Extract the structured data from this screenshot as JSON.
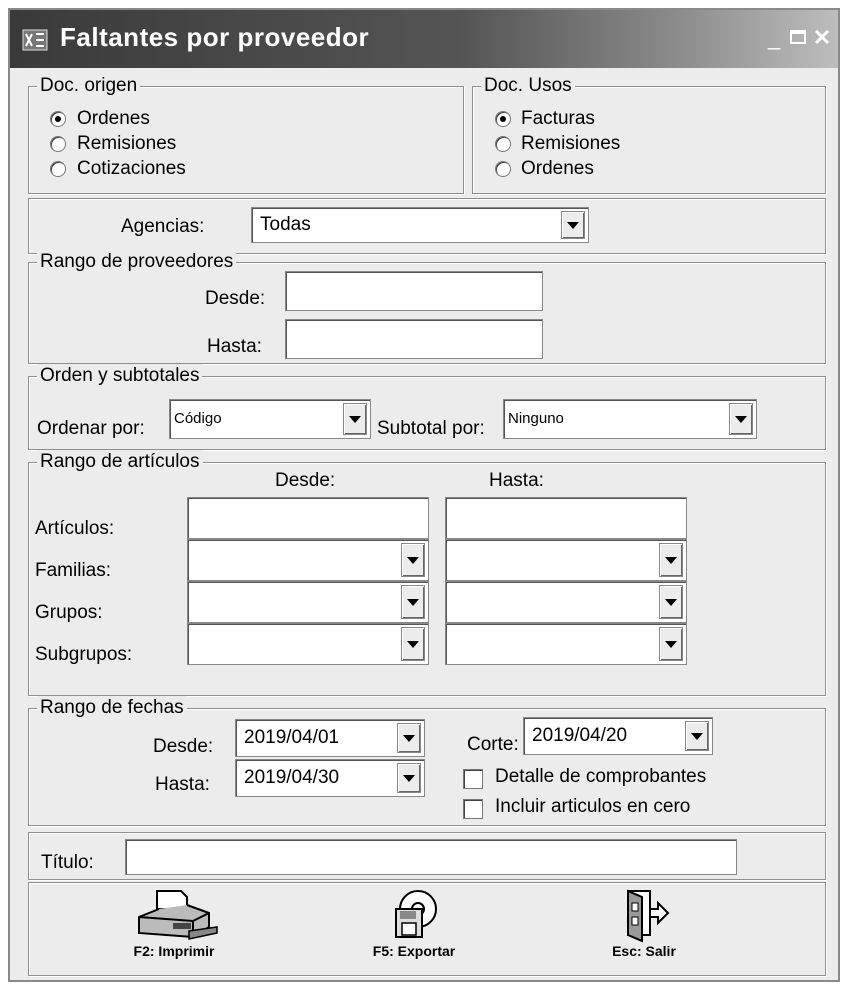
{
  "window": {
    "title": "Faltantes por proveedor"
  },
  "doc_origen": {
    "legend": "Doc. origen",
    "options": [
      "Ordenes",
      "Remisiones",
      "Cotizaciones"
    ],
    "selected": "Ordenes"
  },
  "doc_usos": {
    "legend": "Doc. Usos",
    "options": [
      "Facturas",
      "Remisiones",
      "Ordenes"
    ],
    "selected": "Facturas"
  },
  "agencias": {
    "label": "Agencias:",
    "value": "Todas"
  },
  "rango_proveedores": {
    "legend": "Rango de proveedores",
    "desde_label": "Desde:",
    "desde_value": "",
    "hasta_label": "Hasta:",
    "hasta_value": ""
  },
  "orden": {
    "legend": "Orden y subtotales",
    "ordenar_label": "Ordenar por:",
    "ordenar_value": "Código",
    "subtotal_label": "Subtotal por:",
    "subtotal_value": "Ninguno"
  },
  "rango_articulos": {
    "legend": "Rango de artículos",
    "col_desde": "Desde:",
    "col_hasta": "Hasta:",
    "rows": [
      {
        "label": "Artículos:"
      },
      {
        "label": "Familias:"
      },
      {
        "label": "Grupos:"
      },
      {
        "label": "Subgrupos:"
      }
    ]
  },
  "rango_fechas": {
    "legend": "Rango de fechas",
    "desde_label": "Desde:",
    "desde_value": "2019/04/01",
    "hasta_label": "Hasta:",
    "hasta_value": "2019/04/30",
    "corte_label": "Corte:",
    "corte_value": "2019/04/20",
    "detalle_label": "Detalle de comprobantes",
    "incluir_label": "Incluir articulos en cero"
  },
  "titulo": {
    "label": "Título:",
    "value": ""
  },
  "toolbar": {
    "imprimir": "F2: Imprimir",
    "exportar": "F5: Exportar",
    "salir": "Esc: Salir"
  },
  "icons": {
    "app": "app-icon",
    "printer": "printer-icon",
    "export": "export-disk-icon",
    "exit": "exit-door-icon"
  }
}
